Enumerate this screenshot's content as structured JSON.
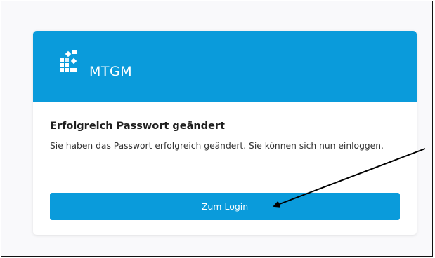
{
  "colors": {
    "brand_blue": "#0a9bdb",
    "background": "#f9f9fb",
    "card": "#ffffff",
    "title_text": "#1f1f1f",
    "body_text": "#333333"
  },
  "header": {
    "logo_icon": "mtgm-logo-icon",
    "brand_name": "MTGM"
  },
  "content": {
    "title": "Erfolgreich Passwort geändert",
    "message": "Sie haben das Passwort erfolgreich geändert. Sie können sich nun einloggen."
  },
  "actions": {
    "login_label": "Zum Login"
  },
  "annotation": {
    "icon": "arrow-annotation-icon"
  }
}
